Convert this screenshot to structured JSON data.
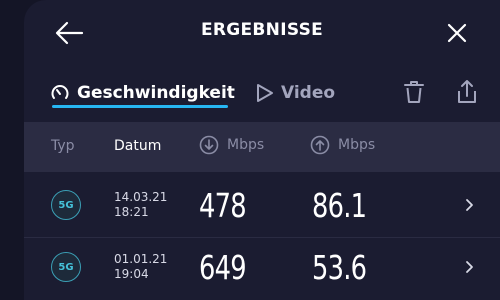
{
  "header": {
    "title": "ERGEBNISSE"
  },
  "tabs": [
    {
      "label": "Geschwindigkeit",
      "active": true,
      "icon": "speedometer-icon"
    },
    {
      "label": "Video",
      "active": false,
      "icon": "play-icon"
    }
  ],
  "columns": {
    "type": "Typ",
    "date": "Datum",
    "download": "Mbps",
    "upload": "Mbps"
  },
  "rows": [
    {
      "type": "5G",
      "date": "14.03.21",
      "time": "18:21",
      "download": "478",
      "upload": "86.1"
    },
    {
      "type": "5G",
      "date": "01.01.21",
      "time": "19:04",
      "download": "649",
      "upload": "53.6"
    }
  ],
  "colors": {
    "accent": "#27b6f2",
    "background": "#1b1c31",
    "header_bar": "#2b2c43",
    "badge": "#45c1d8"
  }
}
